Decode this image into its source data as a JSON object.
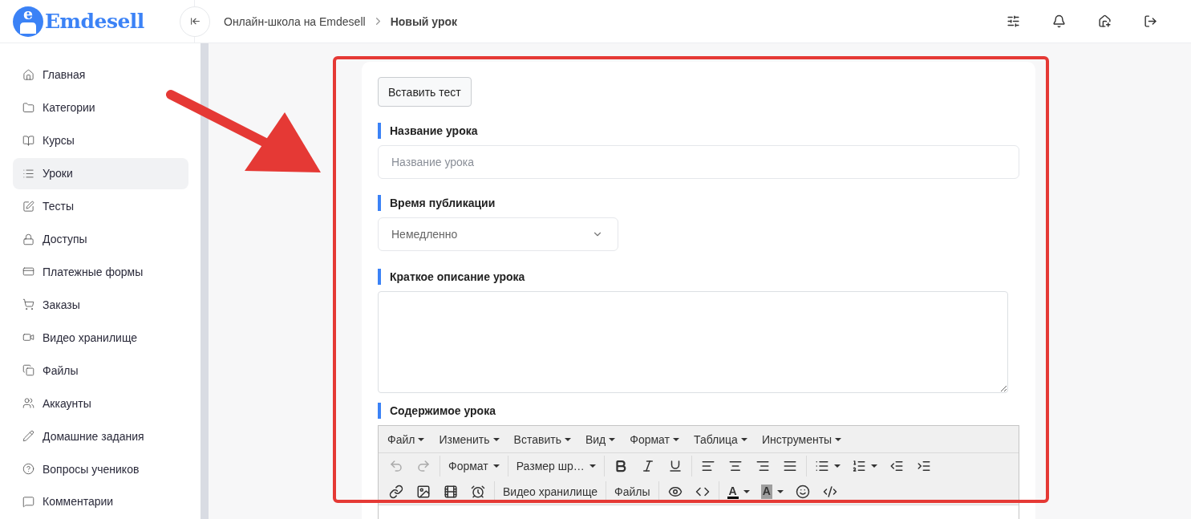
{
  "logo": {
    "mark": "e",
    "name": "Emdesell"
  },
  "breadcrumb": [
    {
      "label": "Онлайн-школа на Emdesell",
      "current": false
    },
    {
      "label": "Новый урок",
      "current": true
    }
  ],
  "sidebar": {
    "items": [
      {
        "label": "Главная",
        "selected": false
      },
      {
        "label": "Категории",
        "selected": false
      },
      {
        "label": "Курсы",
        "selected": false
      },
      {
        "label": "Уроки",
        "selected": true
      },
      {
        "label": "Тесты",
        "selected": false
      },
      {
        "label": "Доступы",
        "selected": false
      },
      {
        "label": "Платежные формы",
        "selected": false
      },
      {
        "label": "Заказы",
        "selected": false
      },
      {
        "label": "Видео хранилище",
        "selected": false
      },
      {
        "label": "Файлы",
        "selected": false
      },
      {
        "label": "Аккаунты",
        "selected": false
      },
      {
        "label": "Домашние задания",
        "selected": false
      },
      {
        "label": "Вопросы учеников",
        "selected": false
      },
      {
        "label": "Комментарии",
        "selected": false
      }
    ]
  },
  "form": {
    "insert_test_button": "Вставить тест",
    "title_label": "Название урока",
    "title_placeholder": "Название урока",
    "publish_label": "Время публикации",
    "publish_value": "Немедленно",
    "summary_label": "Краткое описание урока",
    "content_label": "Содержимое урока"
  },
  "editor": {
    "menubar": [
      {
        "label": "Файл"
      },
      {
        "label": "Изменить"
      },
      {
        "label": "Вставить"
      },
      {
        "label": "Вид"
      },
      {
        "label": "Формат"
      },
      {
        "label": "Таблица"
      },
      {
        "label": "Инструменты"
      }
    ],
    "toolbar_rows": [
      [
        [
          {
            "kind": "icon",
            "disabled": true
          },
          {
            "kind": "icon",
            "disabled": true
          }
        ],
        [
          {
            "kind": "dropdown",
            "label": "Формат"
          }
        ],
        [
          {
            "kind": "dropdown",
            "label": "Размер шр…"
          }
        ],
        [
          {
            "kind": "icon",
            "disabled": false
          },
          {
            "kind": "icon",
            "disabled": false
          },
          {
            "kind": "icon",
            "disabled": false
          }
        ],
        [
          {
            "kind": "icon",
            "disabled": false
          },
          {
            "kind": "icon",
            "disabled": false
          },
          {
            "kind": "icon",
            "disabled": false
          },
          {
            "kind": "icon",
            "disabled": false
          }
        ],
        [
          {
            "kind": "split",
            "disabled": false
          },
          {
            "kind": "split",
            "disabled": false
          },
          {
            "kind": "icon",
            "disabled": false
          },
          {
            "kind": "icon",
            "disabled": false
          }
        ]
      ],
      [
        [
          {
            "kind": "icon",
            "disabled": false
          },
          {
            "kind": "icon",
            "disabled": false
          },
          {
            "kind": "icon",
            "disabled": false
          },
          {
            "kind": "icon",
            "disabled": false
          }
        ],
        [
          {
            "kind": "text",
            "label": "Видео хранилище"
          }
        ],
        [
          {
            "kind": "text",
            "label": "Файлы"
          }
        ],
        [
          {
            "kind": "icon",
            "disabled": false
          },
          {
            "kind": "icon",
            "disabled": false
          }
        ],
        [
          {
            "kind": "text-color",
            "label": "A"
          },
          {
            "kind": "highlight-color",
            "label": "A"
          },
          {
            "kind": "icon",
            "disabled": false
          },
          {
            "kind": "icon",
            "disabled": false
          }
        ]
      ]
    ]
  }
}
